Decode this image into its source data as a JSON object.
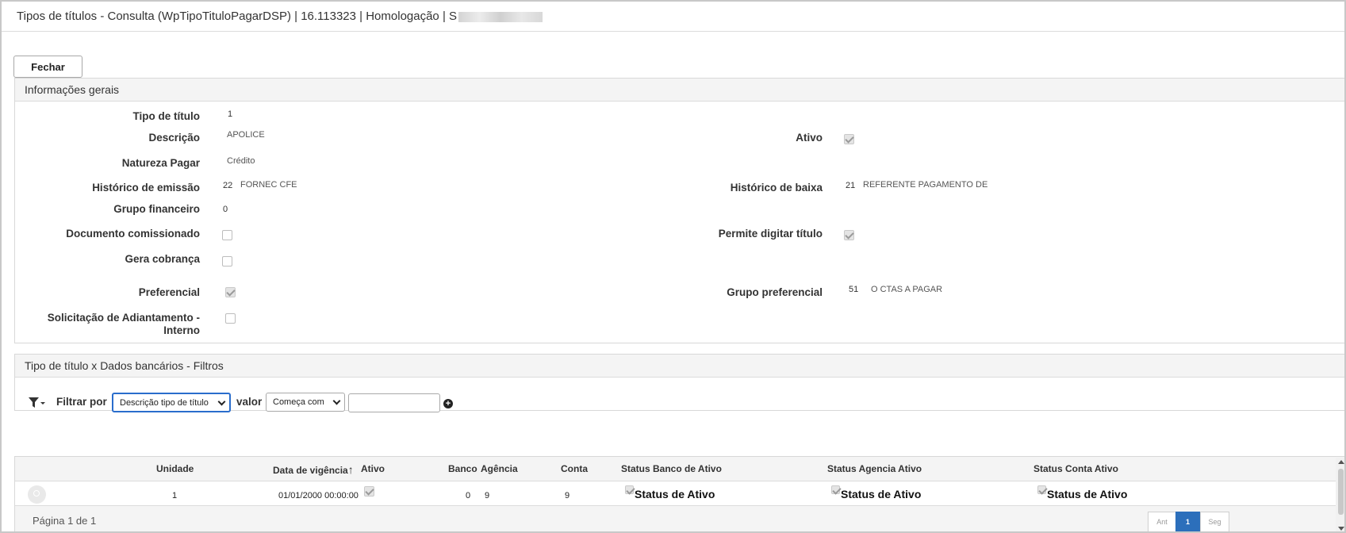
{
  "window": {
    "title": "Tipos de títulos - Consulta (WpTipoTituloPagarDSP) | 16.113323 | Homologação | S"
  },
  "toolbar": {
    "close_label": "Fechar"
  },
  "general": {
    "header": "Informações gerais",
    "tipo_titulo": {
      "label": "Tipo de título",
      "value": "1"
    },
    "descricao": {
      "label": "Descrição",
      "value": "APOLICE"
    },
    "ativo": {
      "label": "Ativo",
      "checked": true
    },
    "natureza": {
      "label": "Natureza Pagar",
      "value": "Crédito"
    },
    "hist_emissao": {
      "label": "Histórico de emissão",
      "code": "22",
      "value": "FORNEC CFE"
    },
    "hist_baixa": {
      "label": "Histórico de baixa",
      "code": "21",
      "value": "REFERENTE PAGAMENTO DE"
    },
    "grupo_financeiro": {
      "label": "Grupo financeiro",
      "value": "0"
    },
    "doc_comissionado": {
      "label": "Documento comissionado",
      "checked": false
    },
    "permite_digitar": {
      "label": "Permite digitar título",
      "checked": true
    },
    "gera_cobranca": {
      "label": "Gera cobrança",
      "checked": false
    },
    "preferencial": {
      "label": "Preferencial",
      "checked": true
    },
    "grupo_preferencial": {
      "label": "Grupo preferencial",
      "code": "51",
      "value": "O CTAS A PAGAR"
    },
    "solicitacao_line1": "Solicitação de Adiantamento -",
    "solicitacao_line2": "Interno",
    "solicitacao_checked": false
  },
  "filters": {
    "header": "Tipo de título x Dados bancários - Filtros",
    "filter_by_label": "Filtrar por",
    "field_selected": "Descrição tipo de título",
    "value_label": "valor",
    "operator_selected": "Começa com",
    "value_input": ""
  },
  "grid": {
    "columns": [
      "Unidade",
      "Data de vigência",
      "Ativo",
      "Banco",
      "Agência",
      "Conta",
      "Status Banco de Ativo",
      "Status Agencia Ativo",
      "Status Conta Ativo"
    ],
    "sort_indicator": "↑",
    "rows": [
      {
        "unidade": "1",
        "data_vigencia": "01/01/2000 00:00:00",
        "ativo": true,
        "banco": "0",
        "agencia": "9",
        "conta": "9",
        "status_banco": "Status de Ativo",
        "status_agencia": "Status de Ativo",
        "status_conta": "Status de Ativo"
      }
    ],
    "pagination": {
      "info": "Página 1 de 1",
      "prev": "Ant",
      "current": "1",
      "next": "Seg"
    }
  },
  "colors": {
    "accent": "#2c6fbb",
    "focus": "#2a6dcc",
    "panel_header_bg": "#f4f4f4",
    "border": "#d8d8d8"
  }
}
